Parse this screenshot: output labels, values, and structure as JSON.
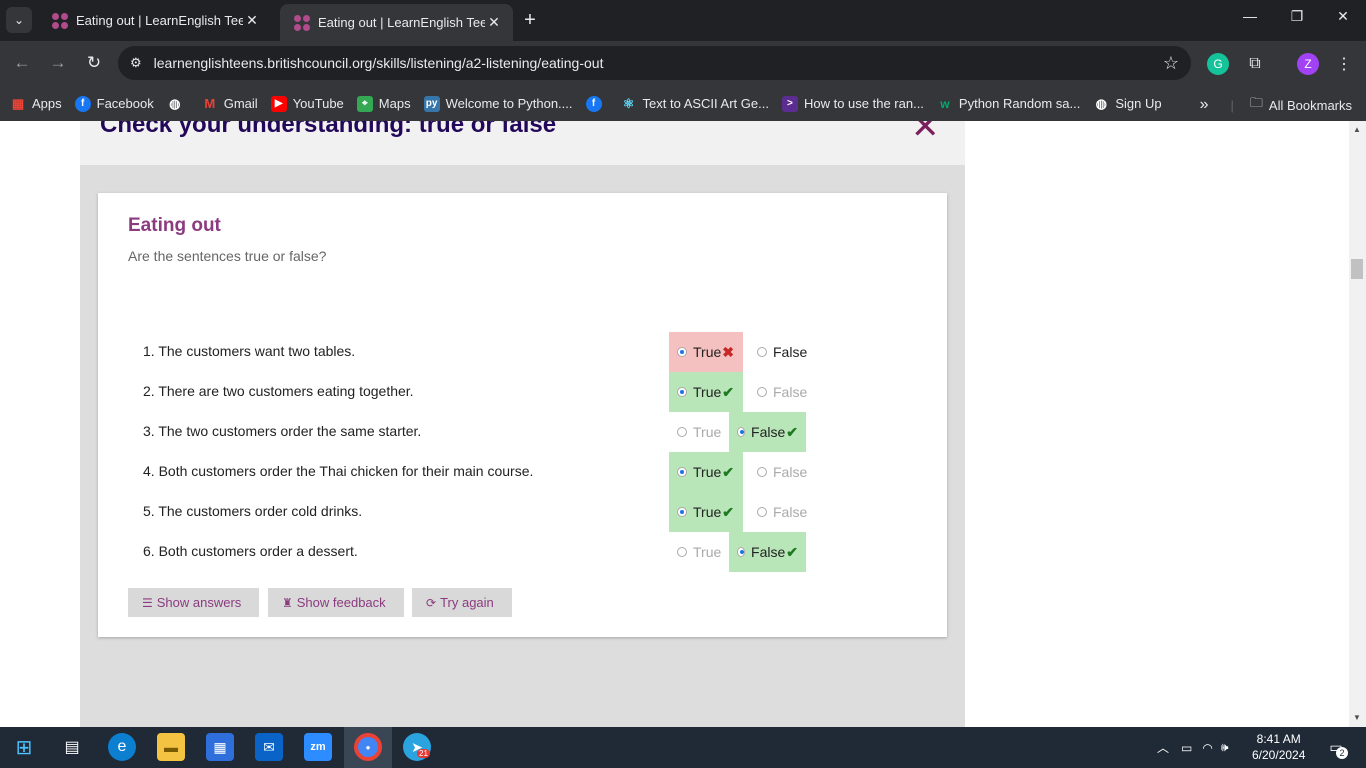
{
  "browser": {
    "tabs": [
      {
        "title": "Eating out | LearnEnglish Teens",
        "close": "✕"
      },
      {
        "title": "Eating out | LearnEnglish Teens",
        "close": "✕"
      }
    ],
    "new_tab": "+",
    "url": "learnenglishteens.britishcouncil.org/skills/listening/a2-listening/eating-out",
    "profile_initial": "Z",
    "bookmarks": [
      {
        "label": "Apps",
        "icon": "apps-grid-icon"
      },
      {
        "label": "Facebook",
        "icon": "facebook-icon"
      },
      {
        "label": "",
        "icon": "globe-icon"
      },
      {
        "label": "Gmail",
        "icon": "gmail-icon"
      },
      {
        "label": "YouTube",
        "icon": "youtube-icon"
      },
      {
        "label": "Maps",
        "icon": "maps-icon"
      },
      {
        "label": "Welcome to Python....",
        "icon": "python-icon"
      },
      {
        "label": "",
        "icon": "facebook-icon"
      },
      {
        "label": "Text to ASCII Art Ge...",
        "icon": "react-icon"
      },
      {
        "label": "How to use the ran...",
        "icon": "terminal-icon"
      },
      {
        "label": "Python Random sa...",
        "icon": "w3schools-icon"
      },
      {
        "label": "Sign Up",
        "icon": "globe-icon"
      }
    ],
    "more_bookmarks": "»",
    "all_bookmarks": "All Bookmarks"
  },
  "page": {
    "panel_title": "Check your understanding: true or false",
    "card_title": "Eating out",
    "instruction": "Are the sentences true or false?",
    "questions": [
      {
        "text": "1. The customers want two tables.",
        "true_label": "True",
        "false_label": "False",
        "selected": "true",
        "result": "wrong"
      },
      {
        "text": "2. There are two customers eating together.",
        "true_label": "True",
        "false_label": "False",
        "selected": "true",
        "result": "correct"
      },
      {
        "text": "3. The two customers order the same starter.",
        "true_label": "True",
        "false_label": "False",
        "selected": "false",
        "result": "correct"
      },
      {
        "text": "4. Both customers order the Thai chicken for their main course.",
        "true_label": "True",
        "false_label": "False",
        "selected": "true",
        "result": "correct"
      },
      {
        "text": "5. The customers order cold drinks.",
        "true_label": "True",
        "false_label": "False",
        "selected": "true",
        "result": "correct"
      },
      {
        "text": "6. Both customers order a dessert.",
        "true_label": "True",
        "false_label": "False",
        "selected": "false",
        "result": "correct"
      }
    ],
    "buttons": {
      "show_answers": "Show answers",
      "show_feedback": "Show feedback",
      "try_again": "Try again"
    }
  },
  "taskbar": {
    "time": "8:41 AM",
    "date": "6/20/2024",
    "notifications": "2",
    "telegram_badge": "21"
  },
  "colors": {
    "correct_bg": "#b8e6b8",
    "wrong_bg": "#f5c0c0",
    "accent": "#8b3b80",
    "heading": "#23085a"
  }
}
